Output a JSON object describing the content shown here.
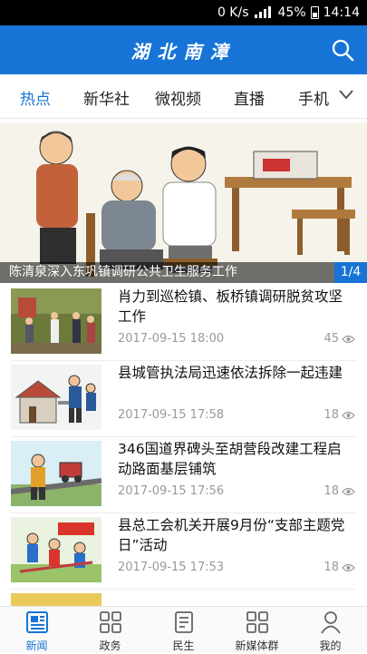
{
  "status_bar": {
    "speed": "0 K/s",
    "network": "3G 4G",
    "battery": "45%",
    "time": "14:14"
  },
  "header": {
    "logo_text": "湖北南漳",
    "search_icon": "search-icon",
    "accent": "#1774d6"
  },
  "tabs": [
    {
      "label": "热点",
      "active": true
    },
    {
      "label": "新华社"
    },
    {
      "label": "微视频"
    },
    {
      "label": "直播"
    },
    {
      "label": "手机"
    }
  ],
  "banner": {
    "caption": "陈清泉深入东巩镇调研公共卫生服务工作",
    "counter": "1/4"
  },
  "news": [
    {
      "title": "肖力到巡检镇、板桥镇调研脱贫攻坚工作",
      "date": "2017-09-15 18:00",
      "views": "45"
    },
    {
      "title": "县城管执法局迅速依法拆除一起违建",
      "date": "2017-09-15 17:58",
      "views": "18"
    },
    {
      "title": "346国道界碑头至胡营段改建工程启动路面基层铺筑",
      "date": "2017-09-15 17:56",
      "views": "18"
    },
    {
      "title": "县总工会机关开展9月份“支部主题党日”活动",
      "date": "2017-09-15 17:53",
      "views": "18"
    }
  ],
  "bottom_nav": [
    {
      "label": "新闻",
      "icon": "news-icon",
      "active": true
    },
    {
      "label": "政务",
      "icon": "grid-icon"
    },
    {
      "label": "民生",
      "icon": "document-icon"
    },
    {
      "label": "新媒体群",
      "icon": "grid-icon"
    },
    {
      "label": "我的",
      "icon": "person-icon"
    }
  ]
}
